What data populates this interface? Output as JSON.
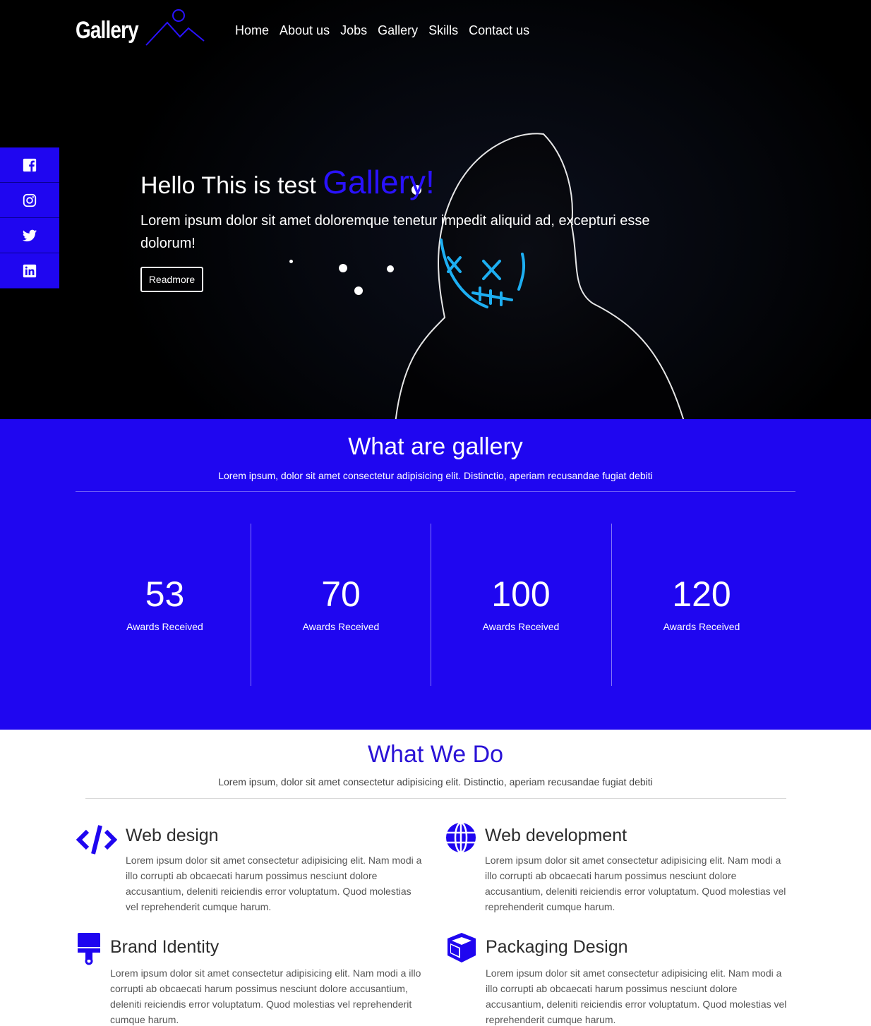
{
  "brand": {
    "logo_text": "Gallery"
  },
  "nav": {
    "links": [
      "Home",
      "About us",
      "Jobs",
      "Gallery",
      "Skills",
      "Contact us"
    ]
  },
  "social": {
    "items": [
      {
        "icon": "facebook-icon"
      },
      {
        "icon": "instagram-icon"
      },
      {
        "icon": "twitter-icon"
      },
      {
        "icon": "linkedin-icon"
      }
    ]
  },
  "hero": {
    "title_prefix": "Hello This is test",
    "title_accent": "Gallery!",
    "description": "Lorem ipsum dolor sit amet doloremque tenetur impedit aliquid ad, excepturi esse dolorum!",
    "button_label": "Readmore"
  },
  "stats": {
    "title": "What are gallery",
    "subtitle": "Lorem ipsum, dolor sit amet consectetur adipisicing elit. Distinctio, aperiam recusandae fugiat debiti",
    "items": [
      {
        "number": "53",
        "label": "Awards Received"
      },
      {
        "number": "70",
        "label": "Awards Received"
      },
      {
        "number": "100",
        "label": "Awards Received"
      },
      {
        "number": "120",
        "label": "Awards Received"
      }
    ]
  },
  "services": {
    "title": "What We Do",
    "subtitle": "Lorem ipsum, dolor sit amet consectetur adipisicing elit. Distinctio, aperiam recusandae fugiat debiti",
    "items": [
      {
        "icon": "code-icon",
        "title": "Web design",
        "text": "Lorem ipsum dolor sit amet consectetur adipisicing elit. Nam modi a illo corrupti ab obcaecati harum possimus nesciunt dolore accusantium, deleniti reiciendis error voluptatum. Quod molestias vel reprehenderit cumque harum."
      },
      {
        "icon": "globe-icon",
        "title": "Web development",
        "text": "Lorem ipsum dolor sit amet consectetur adipisicing elit. Nam modi a illo corrupti ab obcaecati harum possimus nesciunt dolore accusantium, deleniti reiciendis error voluptatum. Quod molestias vel reprehenderit cumque harum."
      },
      {
        "icon": "paint-roller-icon",
        "title": "Brand Identity",
        "text": "Lorem ipsum dolor sit amet consectetur adipisicing elit. Nam modi a illo corrupti ab obcaecati harum possimus nesciunt dolore accusantium, deleniti reiciendis error voluptatum. Quod molestias vel reprehenderit cumque harum."
      },
      {
        "icon": "cube-icon",
        "title": "Packaging Design",
        "text": "Lorem ipsum dolor sit amet consectetur adipisicing elit. Nam modi a illo corrupti ab obcaecati harum possimus nesciunt dolore accusantium, deleniti reiciendis error voluptatum. Quod molestias vel reprehenderit cumque harum."
      }
    ]
  },
  "colors": {
    "accent": "#1f06f0",
    "accent_text": "#2a12d6",
    "hero_bg": "#000000",
    "white": "#ffffff"
  }
}
